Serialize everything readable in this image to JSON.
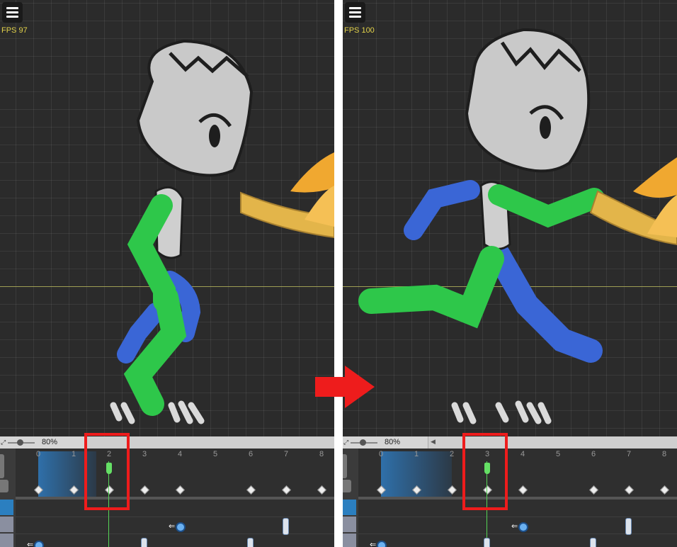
{
  "panels": [
    {
      "fps_label": "FPS 97",
      "zoom_label": "80%",
      "current_frame": 2
    },
    {
      "fps_label": "FPS 100",
      "zoom_label": "80%",
      "current_frame": 3
    }
  ],
  "frame_labels": [
    "0",
    "1",
    "2",
    "3",
    "4",
    "5",
    "6",
    "7",
    "8"
  ],
  "colors": {
    "highlight_box": "#ee1c1c",
    "arrow": "#ee1c1c",
    "playhead": "#65e065",
    "fps_text": "#e3d34a"
  },
  "icons": {
    "menu": "hamburger-menu-icon",
    "zoom": "fit-view-icon",
    "arrow": "right-arrow"
  }
}
